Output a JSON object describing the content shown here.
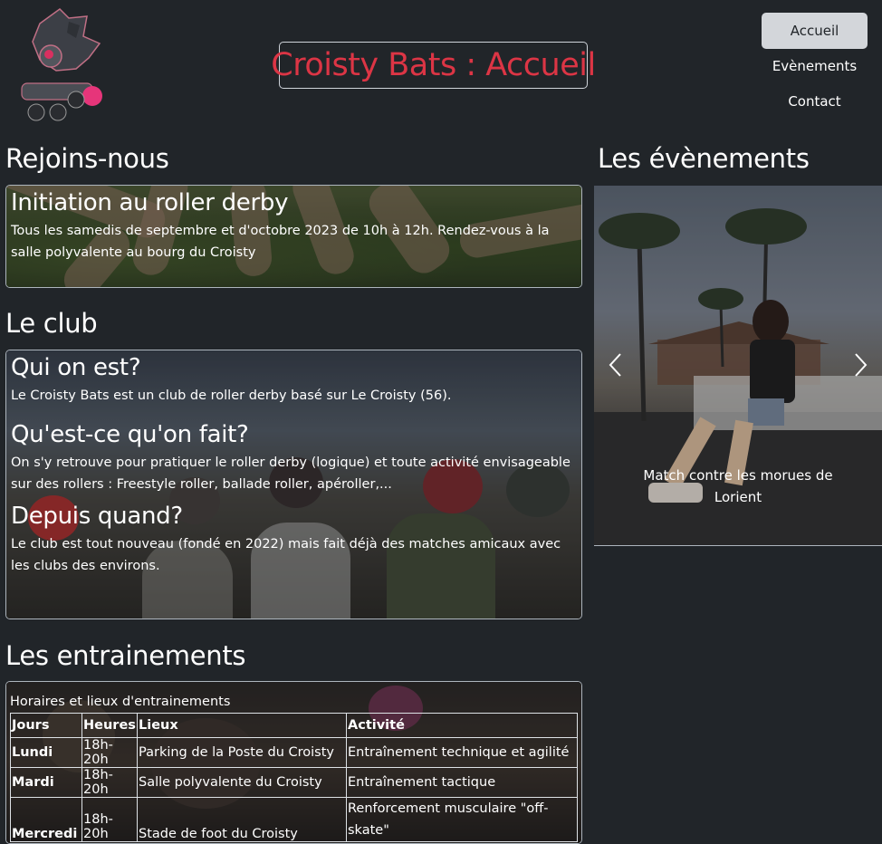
{
  "header": {
    "title": "Croisty Bats : Accueil",
    "nav": [
      "Accueil",
      "Evènements",
      "Contact"
    ],
    "active_nav": "Accueil"
  },
  "join": {
    "heading": "Rejoins-nous",
    "card_title": "Initiation au roller derby",
    "card_text": "Tous les samedis de septembre et d'octobre 2023 de 10h à 12h. Rendez-vous à la salle polyvalente au bourg du Croisty"
  },
  "club": {
    "heading": "Le club",
    "q1_title": "Qui on est?",
    "q1_text": "Le Croisty Bats est un club de roller derby basé sur Le Croisty (56).",
    "q2_title": "Qu'est-ce qu'on fait?",
    "q2_text": "On s'y retrouve pour pratiquer le roller derby (logique) et toute activité envisageable sur des rollers : Freestyle roller, ballade roller, apéroller,...",
    "q3_title": "Depuis quand?",
    "q3_text": "Le club est tout nouveau (fondé en 2022) mais fait déjà des matches amicaux avec les clubs des environs."
  },
  "events": {
    "heading": "Les évènements",
    "caption": "Match contre les morues de Lorient"
  },
  "training": {
    "heading": "Les entrainements",
    "caption": "Horaires et lieux d'entrainements",
    "columns": [
      "Jours",
      "Heures",
      "Lieux",
      "Activité"
    ],
    "rows": [
      [
        "Lundi",
        "18h-20h",
        "Parking de la Poste du Croisty",
        "Entraînement technique et agilité"
      ],
      [
        "Mardi",
        "18h-20h",
        "Salle polyvalente du Croisty",
        "Entraînement tactique"
      ],
      [
        "Mercredi",
        "18h-20h",
        "Stade de foot du Croisty",
        "Renforcement musculaire \"off-skate\""
      ]
    ]
  }
}
